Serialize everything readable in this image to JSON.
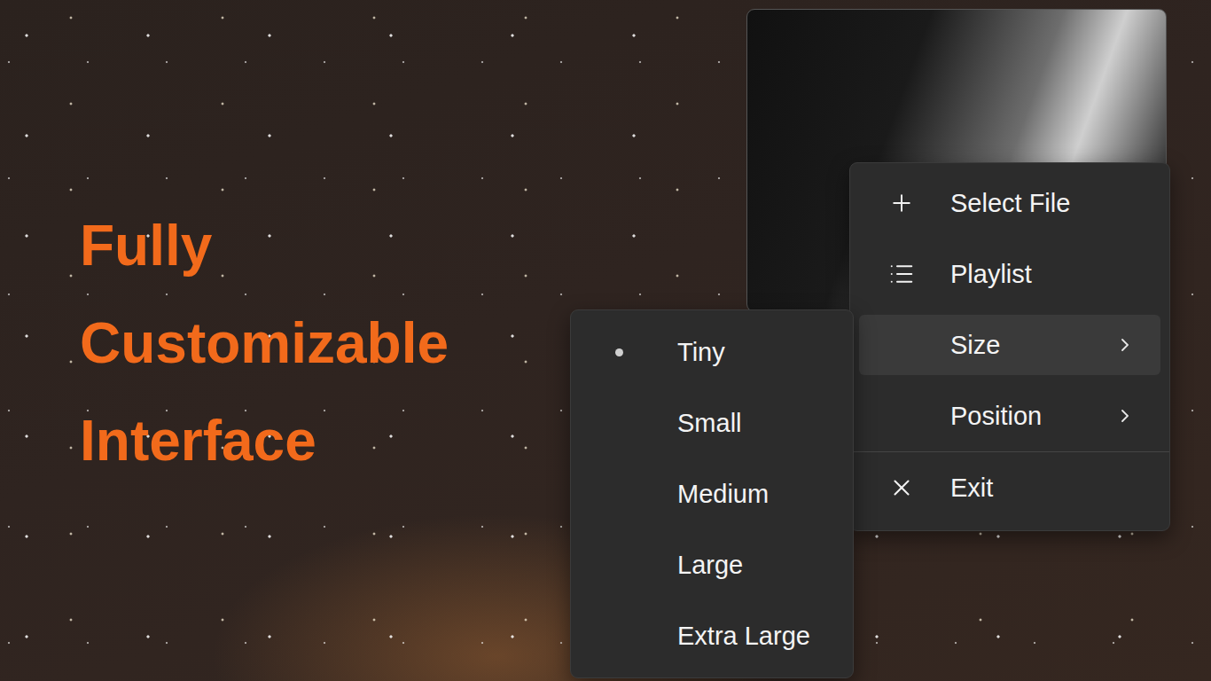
{
  "headline": [
    "Fully",
    "Customizable",
    "Interface"
  ],
  "menu": {
    "items": [
      {
        "label": "Select File",
        "kind": "add",
        "highlighted": false,
        "separator_before": false
      },
      {
        "label": "Playlist",
        "kind": "list",
        "highlighted": false,
        "separator_before": false
      },
      {
        "label": "Size",
        "kind": "submenu",
        "highlighted": true,
        "separator_before": false
      },
      {
        "label": "Position",
        "kind": "submenu",
        "highlighted": false,
        "separator_before": false
      },
      {
        "label": "Exit",
        "kind": "exit",
        "highlighted": false,
        "separator_before": true
      }
    ]
  },
  "submenu": {
    "items": [
      {
        "label": "Tiny",
        "selected": true
      },
      {
        "label": "Small",
        "selected": false
      },
      {
        "label": "Medium",
        "selected": false
      },
      {
        "label": "Large",
        "selected": false
      },
      {
        "label": "Extra Large",
        "selected": false
      }
    ]
  }
}
